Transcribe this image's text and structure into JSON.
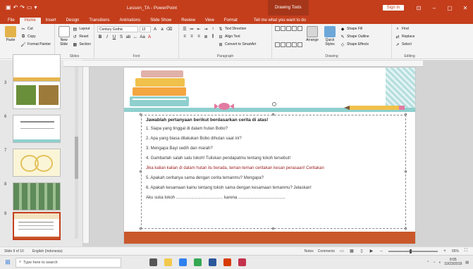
{
  "window": {
    "title": "Lesson_TA - PowerPoint",
    "contextual_tab": "Drawing Tools",
    "sign_in": "Sign in"
  },
  "tabs": [
    "File",
    "Home",
    "Insert",
    "Design",
    "Transitions",
    "Animations",
    "Slide Show",
    "Review",
    "View",
    "Format"
  ],
  "active_tab": "Home",
  "tell_me": "Tell me what you want to do",
  "ribbon": {
    "clipboard": {
      "label": "Clipboard",
      "paste": "Paste",
      "cut": "Cut",
      "copy": "Copy",
      "format_painter": "Format Painter"
    },
    "slides": {
      "label": "Slides",
      "new_slide": "New Slide",
      "layout": "Layout",
      "reset": "Reset",
      "section": "Section"
    },
    "font": {
      "label": "Font",
      "font_name": "Century Gothic",
      "font_size": "12"
    },
    "paragraph": {
      "label": "Paragraph",
      "text_direction": "Text Direction",
      "align_text": "Align Text",
      "convert_smartart": "Convert to SmartArt"
    },
    "drawing": {
      "label": "Drawing",
      "arrange": "Arrange",
      "quick_styles": "Quick Styles",
      "shape_fill": "Shape Fill",
      "shape_outline": "Shape Outline",
      "shape_effects": "Shape Effects"
    },
    "editing": {
      "label": "Editing",
      "find": "Find",
      "replace": "Replace",
      "select": "Select"
    }
  },
  "slides_panel": [
    {
      "number": "",
      "selected": false
    },
    {
      "number": "3",
      "selected": false
    },
    {
      "number": "6",
      "selected": false
    },
    {
      "number": "7",
      "selected": false
    },
    {
      "number": "8",
      "selected": false
    },
    {
      "number": "9",
      "selected": true
    }
  ],
  "slide": {
    "title": "Jawablah pertanyaan berikut berdasarkan cerita di atas!",
    "lines": [
      "1. Siapa yang tinggal di dalam hutan Bobo?",
      "2. Apa yang biasa dilakukan Bobo dihutan saat ini?",
      "3. Mengapa Bayi sedih dan marah?",
      "4. Gambarlah salah satu tokoh! Tuliskan pendapatmu tentang tokoh tersebut!",
      "Jika kalian kalian di dalam hutan itu berada, teman-teman ceritakan kesan perasaan! Ceritakan",
      "5. Apakah ceritanya sama dengan cerita temanmu? Mengapa?",
      "6. Apakah kesamaan kamu tentang tokoh sama dengan kesamaan temanmu? Jelaskan!",
      "Aku suka tokoh ........................................ karena ........................................"
    ]
  },
  "status": {
    "slide_info": "Slide 9 of 10",
    "language": "English (Indonesia)",
    "notes": "Notes",
    "comments": "Comments",
    "zoom": "65%",
    "zoom_fraction": 0.45
  },
  "taskbar": {
    "search_placeholder": "Type here to search",
    "time": "9:05",
    "date": "10/23/2019"
  },
  "colors": {
    "accent": "#c43e1c",
    "teal": "#8fd0cf",
    "orange_band": "#c9582b"
  }
}
